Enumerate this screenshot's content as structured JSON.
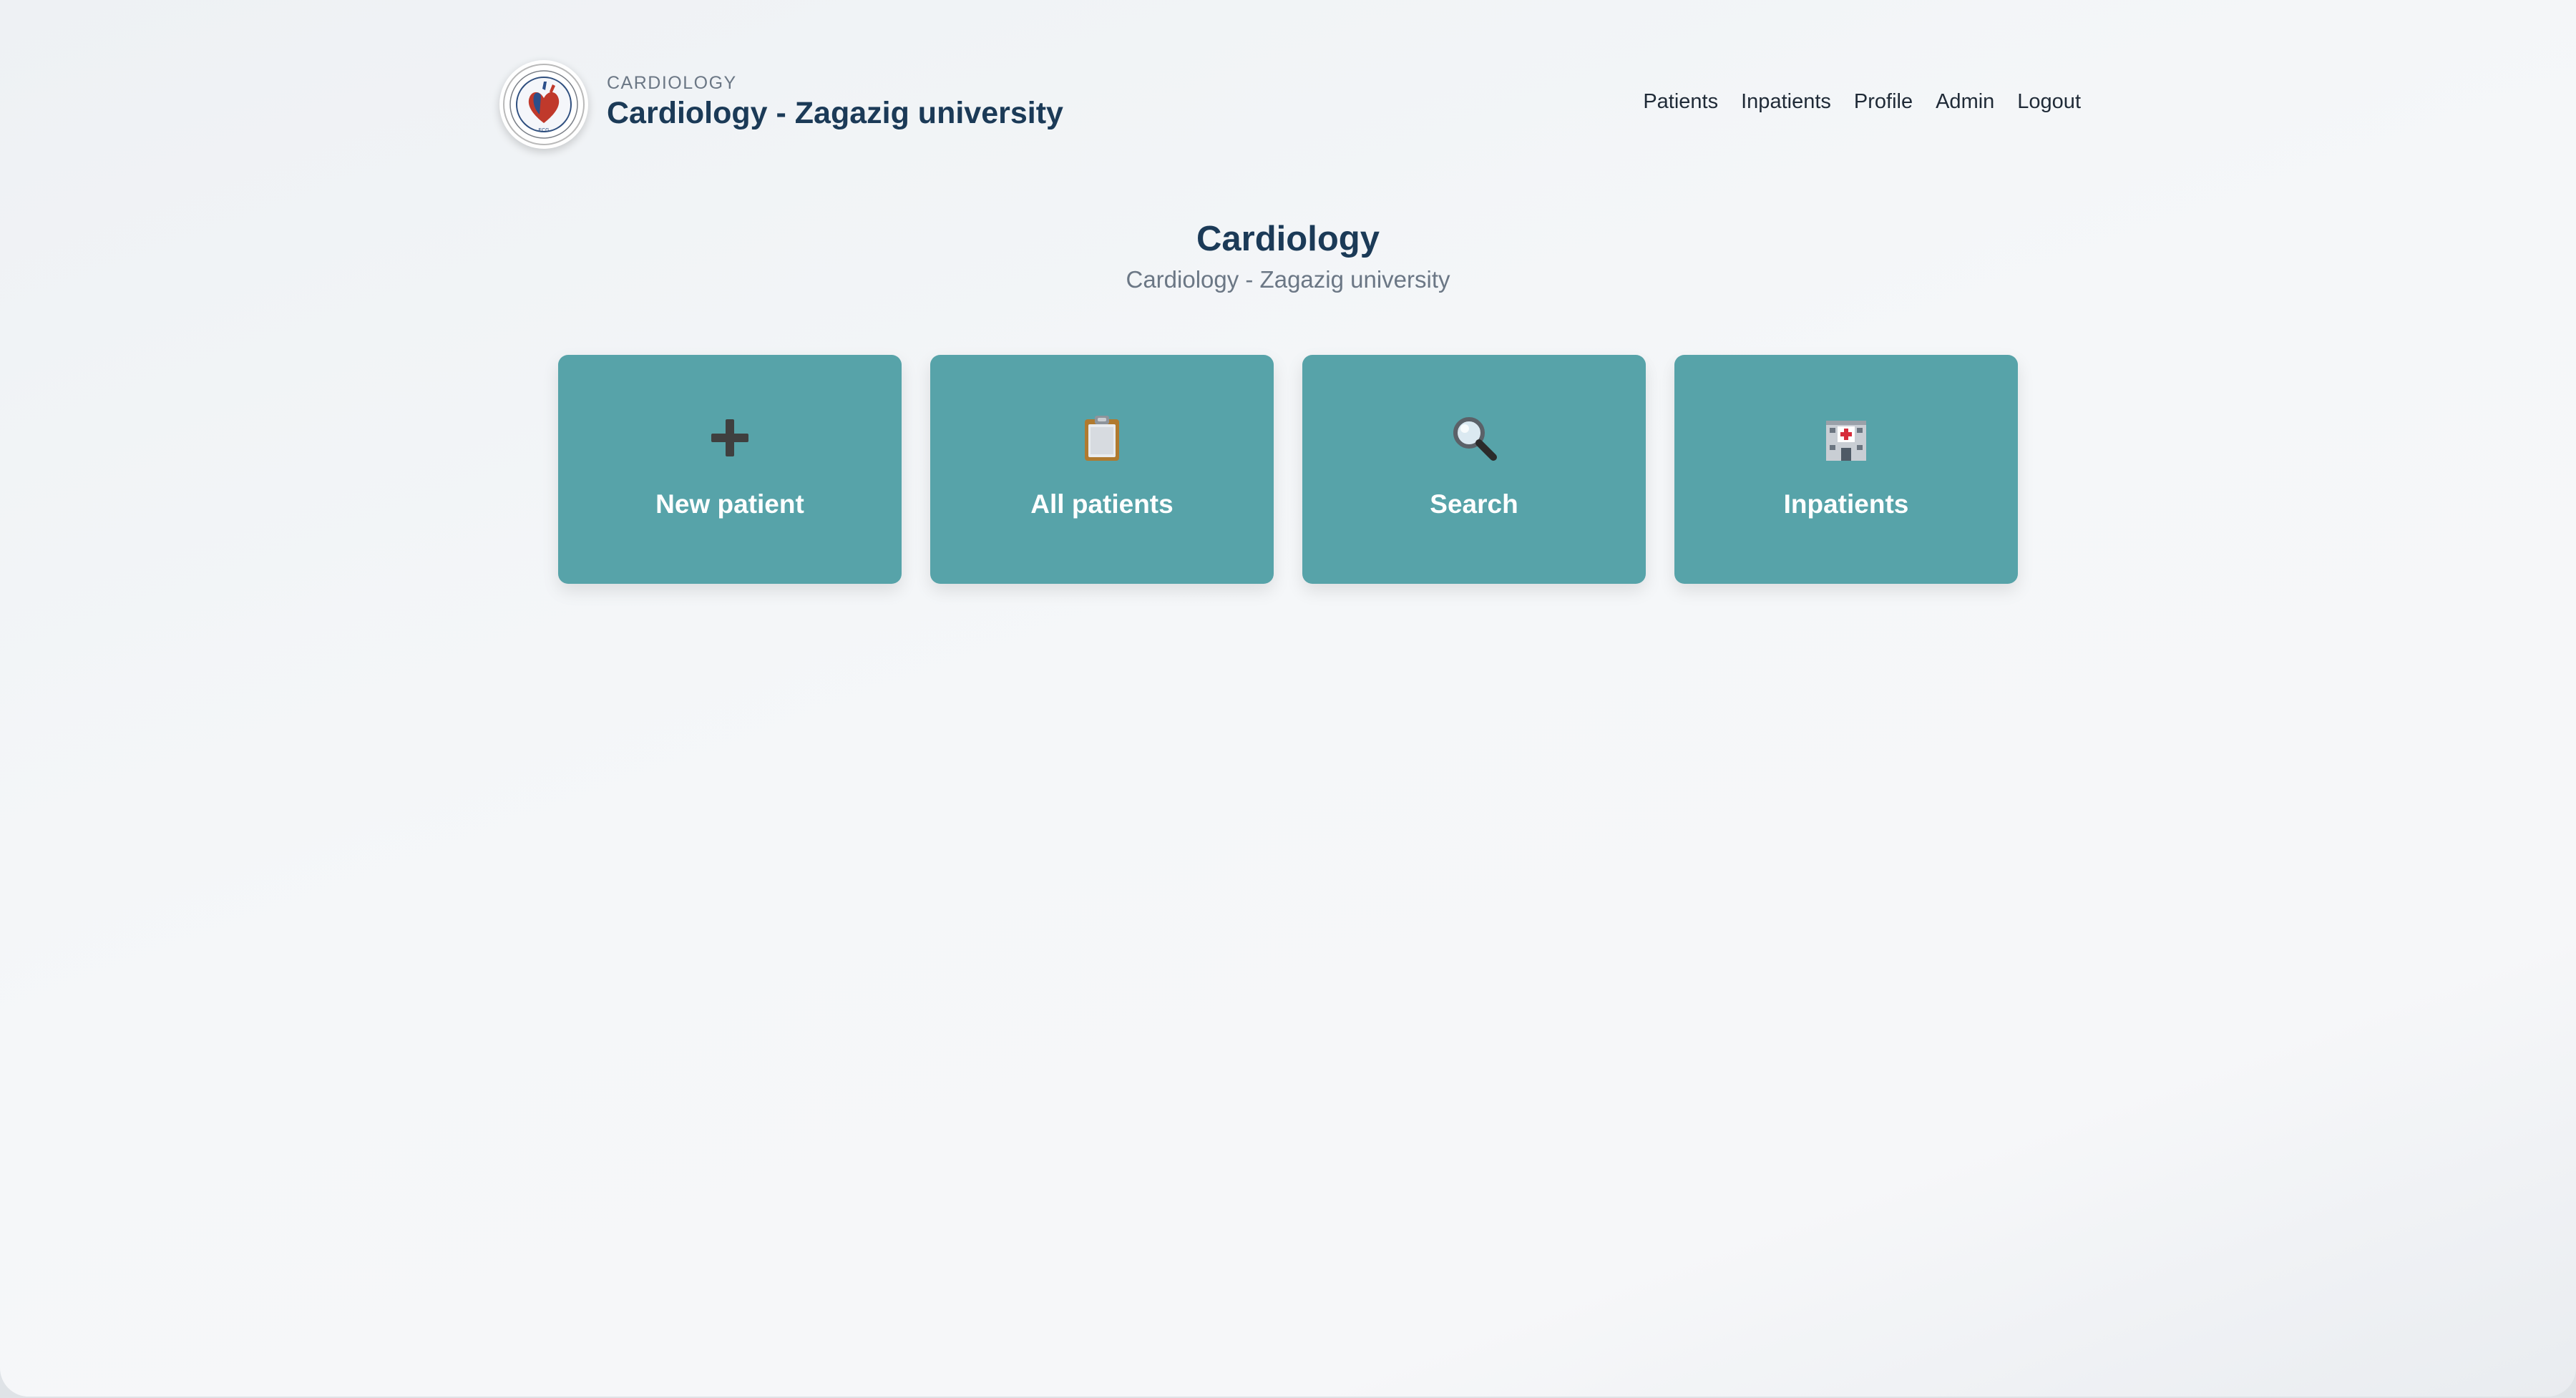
{
  "header": {
    "kicker": "CARDIOLOGY",
    "title": "Cardiology - Zagazig university"
  },
  "nav": {
    "items": [
      {
        "label": "Patients"
      },
      {
        "label": "Inpatients"
      },
      {
        "label": "Profile"
      },
      {
        "label": "Admin"
      },
      {
        "label": "Logout"
      }
    ]
  },
  "hero": {
    "title": "Cardiology",
    "subtitle": "Cardiology - Zagazig university"
  },
  "tiles": [
    {
      "label": "New patient",
      "icon": "plus-icon"
    },
    {
      "label": "All patients",
      "icon": "clipboard-icon"
    },
    {
      "label": "Search",
      "icon": "magnifier-icon"
    },
    {
      "label": "Inpatients",
      "icon": "hospital-icon"
    }
  ],
  "colors": {
    "tile": "#57a3a9",
    "title": "#1b3a57",
    "muted": "#6b7785",
    "background": "#f5f7f9"
  }
}
